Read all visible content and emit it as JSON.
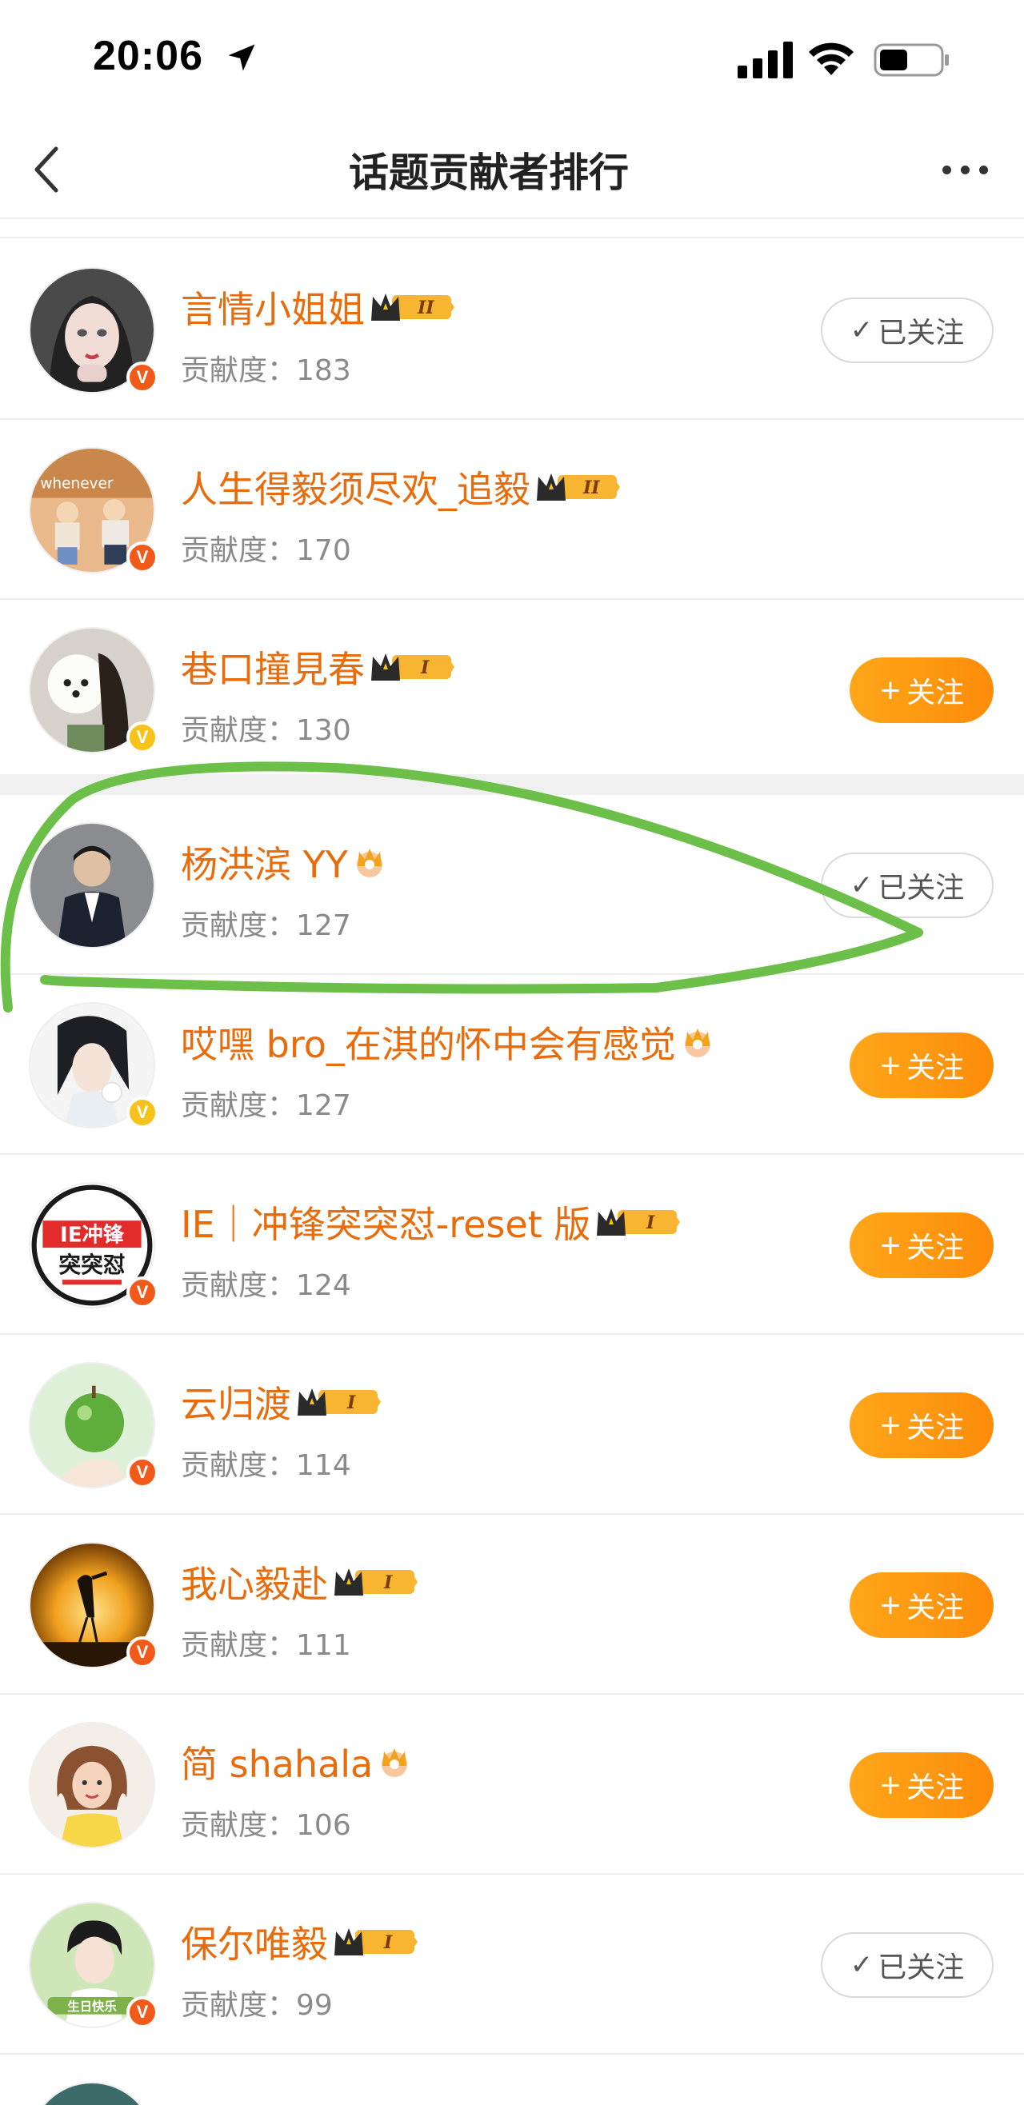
{
  "status_bar": {
    "time": "20:06"
  },
  "nav": {
    "title": "话题贡献者排行"
  },
  "score_label": "贡献度：",
  "buttons": {
    "follow": "关注",
    "followed": "已关注"
  },
  "rows": [
    {
      "name": "言情小姐姐",
      "score": "183",
      "followed": true,
      "level": "II",
      "verify": "orange"
    },
    {
      "name": "人生得毅须尽欢_追毅",
      "score": "170",
      "followed": null,
      "level": "II",
      "verify": "orange"
    },
    {
      "name": "巷口撞見春",
      "score": "130",
      "followed": false,
      "level": "I",
      "verify": "gold"
    },
    {
      "name": "杨洪滨 YY",
      "score": "127",
      "followed": true,
      "level": "",
      "verify": ""
    },
    {
      "name": "哎嘿 bro_在淇的怀中会有感觉",
      "score": "127",
      "followed": false,
      "level": "",
      "verify": "gold"
    },
    {
      "name": "IE｜冲锋突突怼-reset 版",
      "score": "124",
      "followed": false,
      "level": "I",
      "verify": "orange"
    },
    {
      "name": "云归渡",
      "score": "114",
      "followed": false,
      "level": "I",
      "verify": "orange"
    },
    {
      "name": "我心毅赴",
      "score": "111",
      "followed": false,
      "level": "I",
      "verify": "orange"
    },
    {
      "name": "简 shahala",
      "score": "106",
      "followed": false,
      "level": "",
      "verify": ""
    },
    {
      "name": "保尔唯毅",
      "score": "99",
      "followed": true,
      "level": "I",
      "verify": "orange"
    }
  ],
  "avatar_texts": {
    "row2": "whenever",
    "row6_line1": "IE冲锋",
    "row6_line2": "突突怼",
    "row10": "生日快乐"
  },
  "colors": {
    "name": "#e86b0c",
    "follow_button": "#fc8c0a",
    "annotation_stroke": "#6cbf48"
  }
}
